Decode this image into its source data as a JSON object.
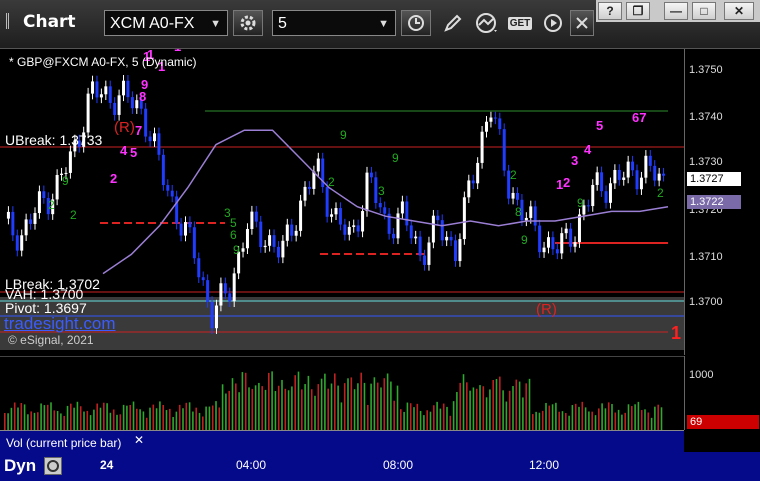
{
  "window": {
    "title": "Chart"
  },
  "toolbar": {
    "symbol": "XCM A0-FX",
    "interval": "5",
    "settings_icon": "gear-icon",
    "clock_icon": "clock-icon",
    "pencil_icon": "pencil-icon",
    "study_icon": "line-chart-icon",
    "get_label": "GET",
    "play_icon": "play-icon",
    "close_icon": "close-icon"
  },
  "window_buttons": {
    "help": "?",
    "restore": "❐",
    "minimize": "—",
    "maximize": "□",
    "close": "✕"
  },
  "chart": {
    "title": "* GBP@FXCM A0-FX, 5 (Dynamic)",
    "ubreak": "UBreak: 1.3733",
    "lbreak": "LBreak: 1.3702",
    "vah": "VAH: 1.3700",
    "pivot": "Pivot: 1.3697",
    "brand": "tradesight.com",
    "copyright": "© eSignal, 2021",
    "marker_r1": "(R)",
    "marker_r2": "(R)",
    "marker_1": "1"
  },
  "price_axis": {
    "ticks": [
      "1.3750",
      "1.3740",
      "1.3730",
      "1.3720",
      "1.3710",
      "1.3700"
    ],
    "last_price": "1.3727",
    "ma_price": "1.3722"
  },
  "volume": {
    "label": "Vol (current price bar)",
    "tick": "1000",
    "last": "69",
    "close_icon": "close-icon"
  },
  "time_axis": {
    "mode": "Dyn",
    "labels": [
      "24",
      "04:00",
      "08:00",
      "12:00"
    ]
  },
  "colors": {
    "up_bar": "#ffffff",
    "down_bar": "#1f3cff",
    "ma_line": "#9b7fd4",
    "setup_count_up": "#ff33ff",
    "setup_count_down": "#22aa22",
    "break_line": "#cc2222",
    "vah_line": "#66dddd",
    "pivot_line": "#3355ff",
    "vol_up": "#2ea82e",
    "vol_down": "#c02020"
  },
  "chart_data": {
    "type": "candlestick",
    "x": [
      "24",
      "04:00",
      "08:00",
      "12:00"
    ],
    "ylim": [
      1.3692,
      1.3755
    ],
    "levels": {
      "UBreak": 1.3733,
      "LBreak": 1.3702,
      "VAH": 1.37,
      "Pivot": 1.3697
    },
    "close_path": [
      1.3718,
      1.3716,
      1.3722,
      1.3726,
      1.3733,
      1.3746,
      1.3745,
      1.3745,
      1.3742,
      1.373,
      1.372,
      1.3712,
      1.3699,
      1.3705,
      1.3718,
      1.3716,
      1.3712,
      1.3722,
      1.373,
      1.372,
      1.3715,
      1.3728,
      1.3718,
      1.372,
      1.3712,
      1.3718,
      1.3713,
      1.3728,
      1.3744,
      1.3727,
      1.372,
      1.3715,
      1.3713,
      1.3718,
      1.3726,
      1.3727,
      1.3729,
      1.373,
      1.3727
    ],
    "ma_path": [
      1.3708,
      1.3712,
      1.3718,
      1.3726,
      1.3735,
      1.3738,
      1.3738,
      1.3732,
      1.3726,
      1.3722,
      1.372,
      1.3719,
      1.3718,
      1.3719,
      1.3718,
      1.3719,
      1.3719,
      1.372,
      1.3721,
      1.3721,
      1.3722
    ]
  }
}
